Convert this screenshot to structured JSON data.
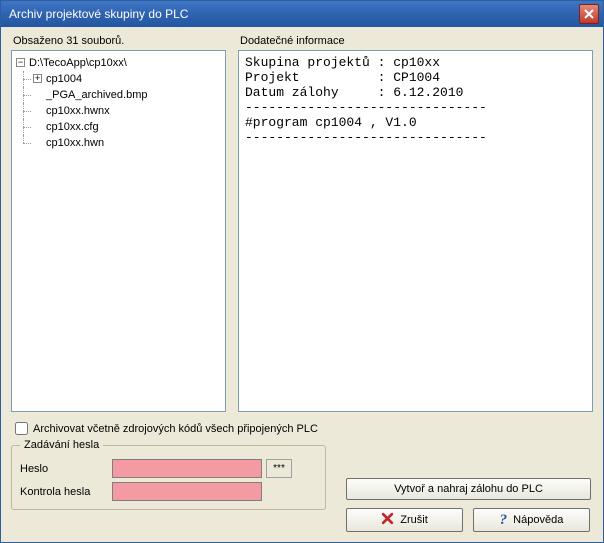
{
  "window": {
    "title": "Archiv projektové skupiny do PLC"
  },
  "left": {
    "header": "Obsaženo 31 souborů.",
    "root": "D:\\TecoApp\\cp10xx\\",
    "nodes": [
      {
        "label": "cp1004",
        "expandable": true
      },
      {
        "label": "_PGA_archived.bmp",
        "expandable": false
      },
      {
        "label": "cp10xx.hwnx",
        "expandable": false
      },
      {
        "label": "cp10xx.cfg",
        "expandable": false
      },
      {
        "label": "cp10xx.hwn",
        "expandable": false
      }
    ]
  },
  "right": {
    "header": "Dodatečné informace",
    "text": "Skupina projektů : cp10xx\nProjekt          : CP1004\nDatum zálohy     : 6.12.2010\n-------------------------------\n#program cp1004 , V1.0\n-------------------------------"
  },
  "checkbox": {
    "label": "Archivovat včetně zdrojových kódů všech připojených PLC"
  },
  "password": {
    "legend": "Zadávání hesla",
    "label1": "Heslo",
    "label2": "Kontrola hesla",
    "stars": "***"
  },
  "buttons": {
    "createUpload": "Vytvoř a nahraj zálohu do PLC",
    "cancel": "Zrušit",
    "help": "Nápověda"
  }
}
